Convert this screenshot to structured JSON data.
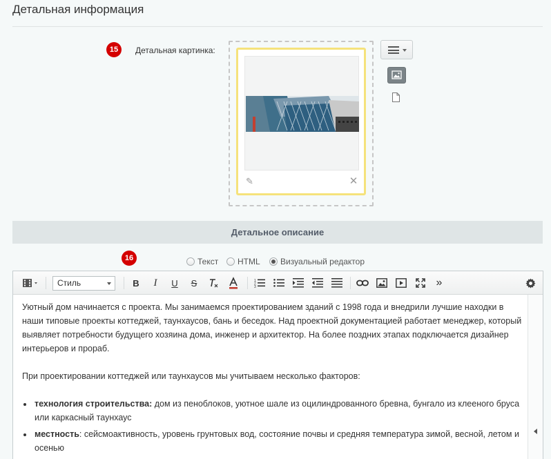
{
  "section": {
    "title": "Детальная информация"
  },
  "badges": {
    "image": "15",
    "editor": "16"
  },
  "detail_image": {
    "label": "Детальная картинка:"
  },
  "description": {
    "header": "Детальное описание",
    "modes": {
      "text": "Текст",
      "html": "HTML",
      "visual": "Визуальный редактор",
      "selected": "visual"
    }
  },
  "toolbar": {
    "style_select": "Стиль",
    "more": "»"
  },
  "content": {
    "p1": "Уютный дом начинается с проекта. Мы занимаемся проектированием зданий с 1998 года и внедрили лучшие находки в наши типовые проекты коттеджей, таунхаусов, бань и беседок. Над проектной документацией работает менеджер, который выявляет потребности будущего хозяина дома, инженер и архитектор. На более поздних этапах подключается дизайнер интерьеров и прораб.",
    "p2": "При проектировании коттеджей или таунхаусов мы учитываем несколько факторов:",
    "items": [
      {
        "bold": "технология строительства:",
        "text": " дом из пеноблоков, уютное шале из оцилиндрованного бревна, бунгало из клееного бруса или каркасный таунхаус"
      },
      {
        "bold": "местность",
        "text": ": сейсмоактивность, уровень грунтовых вод, состояние почвы и средняя температура зимой, весной, летом и осенью"
      }
    ]
  }
}
